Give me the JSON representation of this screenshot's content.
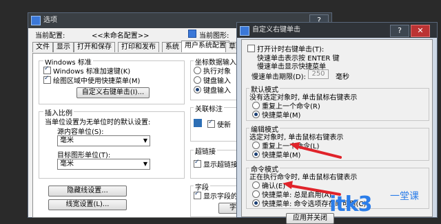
{
  "back_window": {
    "title": "选项",
    "current_profile_label": "当前配置:",
    "current_profile_value": "<<未命名配置>>",
    "current_drawing_label": "当前图形:",
    "tabs": [
      "文件",
      "显示",
      "打开和保存",
      "打印和发布",
      "系统",
      "用户系统配置",
      "草图"
    ],
    "windows_std": {
      "legend": "Windows 标准",
      "dblclick": "Windows 标准加速键(K)",
      "shortcut": "绘图区域中使用快捷菜单(M)",
      "custom_btn": "自定义右键单击(I)..."
    },
    "insert_scale": {
      "legend": "插入比例",
      "desc": "当单位设置为无单位时的默认设置:",
      "source_label": "源内容单位(S):",
      "source_value": "毫米",
      "target_label": "目标图形单位(T):",
      "target_value": "毫米"
    },
    "hidden_btn": "隐藏线设置...",
    "lineweight_btn": "线宽设置(L)...",
    "coord": {
      "legend": "坐标数据输入的",
      "opt1": "执行对象",
      "opt2": "键盘输入",
      "opt3": "键盘输入"
    },
    "assoc": {
      "legend": "关联标注",
      "opt": "使新"
    },
    "hyperlink": {
      "legend": "超链接",
      "opt": "显示超链接"
    },
    "field": {
      "legend": "字段",
      "opt": "显示字段的",
      "btn": "字"
    }
  },
  "dialog": {
    "title": "自定义右键单击",
    "timed": {
      "label": "打开计时右键单击(T):",
      "line1": "快速单击表示按 ENTER 键",
      "line2": "慢速单击显示快捷菜单",
      "duration_label": "慢速单击期限(D):",
      "duration_value": "250",
      "duration_unit": "毫秒"
    },
    "default_mode": {
      "legend": "默认模式",
      "desc": "没有选定对象时, 单击鼠标右键表示",
      "opt1": "重复上一个命令(R)",
      "opt2": "快捷菜单(M)"
    },
    "edit_mode": {
      "legend": "编辑模式",
      "desc": "选定对象时, 单击鼠标右键表示",
      "opt1": "重复上一个命令(L)",
      "opt2": "快捷菜单(M)"
    },
    "command_mode": {
      "legend": "命令模式",
      "desc": "正在执行命令时, 单击鼠标右键表示",
      "opt1": "确认(E)",
      "opt2": "快捷菜单: 总是启用(A)",
      "opt3": "快捷菜单: 命令选项存在时可用(C)"
    },
    "apply_btn": "应用并关闭"
  },
  "watermark": {
    "text": "itk3",
    "sub": "一堂课"
  },
  "colors": {
    "accent": "#2b7de9",
    "arrow": "#e0232a"
  }
}
